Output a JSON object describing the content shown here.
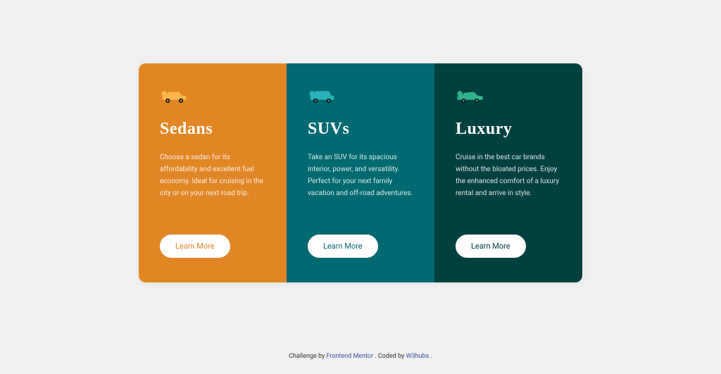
{
  "cards": [
    {
      "id": "sedans",
      "title": "Sedans",
      "text": "Choose a sedan for its affordability and excellent fuel economy. Ideal for cruising in the city or on your next road trip.",
      "cta": "Learn More",
      "icon_color": "#fdb74a"
    },
    {
      "id": "suvs",
      "title": "SUVs",
      "text": "Take an SUV for its spacious interior, power, and versatility. Perfect for your next family vacation and off-road adventures.",
      "cta": "Learn More",
      "icon_color": "#2ab0b9"
    },
    {
      "id": "luxury",
      "title": "Luxury",
      "text": "Cruise in the best car brands without the bloated prices. Enjoy the enhanced comfort of a luxury rental and arrive in style.",
      "cta": "Learn More",
      "icon_color": "#2fb28a"
    }
  ],
  "attribution": {
    "prefix": "Challenge by ",
    "link1": "Frontend Mentor",
    "middle": ". Coded by ",
    "link2": "W3hubs",
    "suffix": "."
  }
}
